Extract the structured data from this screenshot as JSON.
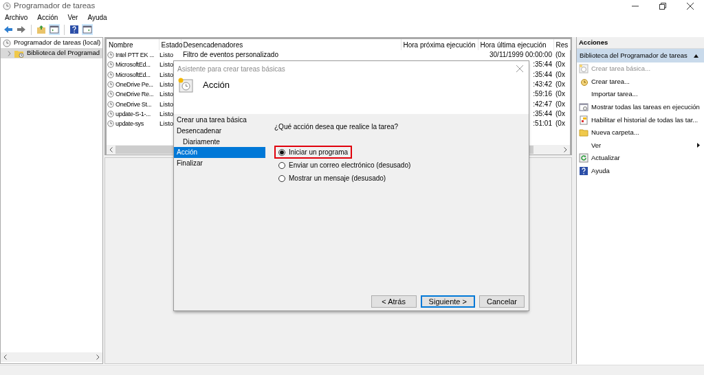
{
  "window": {
    "title": "Programador de tareas"
  },
  "menu": [
    "Archivo",
    "Acción",
    "Ver",
    "Ayuda"
  ],
  "tree": [
    {
      "label": "Programador de tareas (local)",
      "selected": false,
      "children": [
        {
          "label": "Biblioteca del Programad",
          "selected": true,
          "expanded": false
        }
      ]
    }
  ],
  "table": {
    "columns": [
      "Nombre",
      "Estado",
      "Desencadenadores",
      "Hora próxima ejecución",
      "Hora última ejecución",
      "Res"
    ],
    "rows": [
      {
        "name": "Intel PTT EK ...",
        "status": "Listo",
        "trigger": "Filtro de eventos personalizado",
        "last_run": "30/11/1999 00:00:00",
        "result": "(0x"
      },
      {
        "name": "MicrosoftEd...",
        "status": "Listo",
        "last_run": ":35:44",
        "result": "(0x"
      },
      {
        "name": "MicrosoftEd...",
        "status": "Listo",
        "last_run": ":35:44",
        "result": "(0x"
      },
      {
        "name": "OneDrive Pe...",
        "status": "Listo",
        "last_run": ":43:42",
        "result": "(0x"
      },
      {
        "name": "OneDrive Re...",
        "status": "Listo",
        "last_run": ":59:16",
        "result": "(0x"
      },
      {
        "name": "OneDrive St...",
        "status": "Listo",
        "last_run": ":42:47",
        "result": "(0x"
      },
      {
        "name": "update-S-1-...",
        "status": "Listo",
        "last_run": ":35:44",
        "result": "(0x"
      },
      {
        "name": "update-sys",
        "status": "Listo",
        "last_run": ":51:01",
        "result": "(0x"
      }
    ]
  },
  "actions": {
    "title": "Acciones",
    "section": "Biblioteca del Programador de tareas",
    "items": [
      {
        "label": "Crear tarea básica...",
        "disabled": true,
        "submenu": false
      },
      {
        "label": "Crear tarea...",
        "disabled": false,
        "submenu": false
      },
      {
        "label": "Importar tarea...",
        "disabled": false,
        "submenu": false
      },
      {
        "label": "Mostrar todas las tareas en ejecución",
        "disabled": false,
        "submenu": false
      },
      {
        "label": "Habilitar el historial de todas las tar...",
        "disabled": false,
        "submenu": false
      },
      {
        "label": "Nueva carpeta...",
        "disabled": false,
        "submenu": false
      },
      {
        "label": "Ver",
        "disabled": false,
        "submenu": true
      },
      {
        "label": "Actualizar",
        "disabled": false,
        "submenu": false
      },
      {
        "label": "Ayuda",
        "disabled": false,
        "submenu": false
      }
    ]
  },
  "dialog": {
    "title": "Asistente para crear tareas básicas",
    "heading": "Acción",
    "steps": [
      {
        "label": "Crear una tarea básica",
        "selected": false
      },
      {
        "label": "Desencadenar",
        "selected": false,
        "children": [
          {
            "label": "Diariamente",
            "selected": false
          }
        ]
      },
      {
        "label": "Acción",
        "selected": true
      },
      {
        "label": "Finalizar",
        "selected": false
      }
    ],
    "question": "¿Qué acción desea que realice la tarea?",
    "options": [
      {
        "label": "Iniciar un programa",
        "selected": true,
        "highlighted": true
      },
      {
        "label": "Enviar un correo electrónico (desusado)",
        "selected": false,
        "highlighted": false
      },
      {
        "label": "Mostrar un mensaje (desusado)",
        "selected": false,
        "highlighted": false
      }
    ],
    "buttons": [
      {
        "label": "< Atrás",
        "default": false
      },
      {
        "label": "Siguiente >",
        "default": true
      },
      {
        "label": "Cancelar",
        "default": false
      }
    ]
  }
}
